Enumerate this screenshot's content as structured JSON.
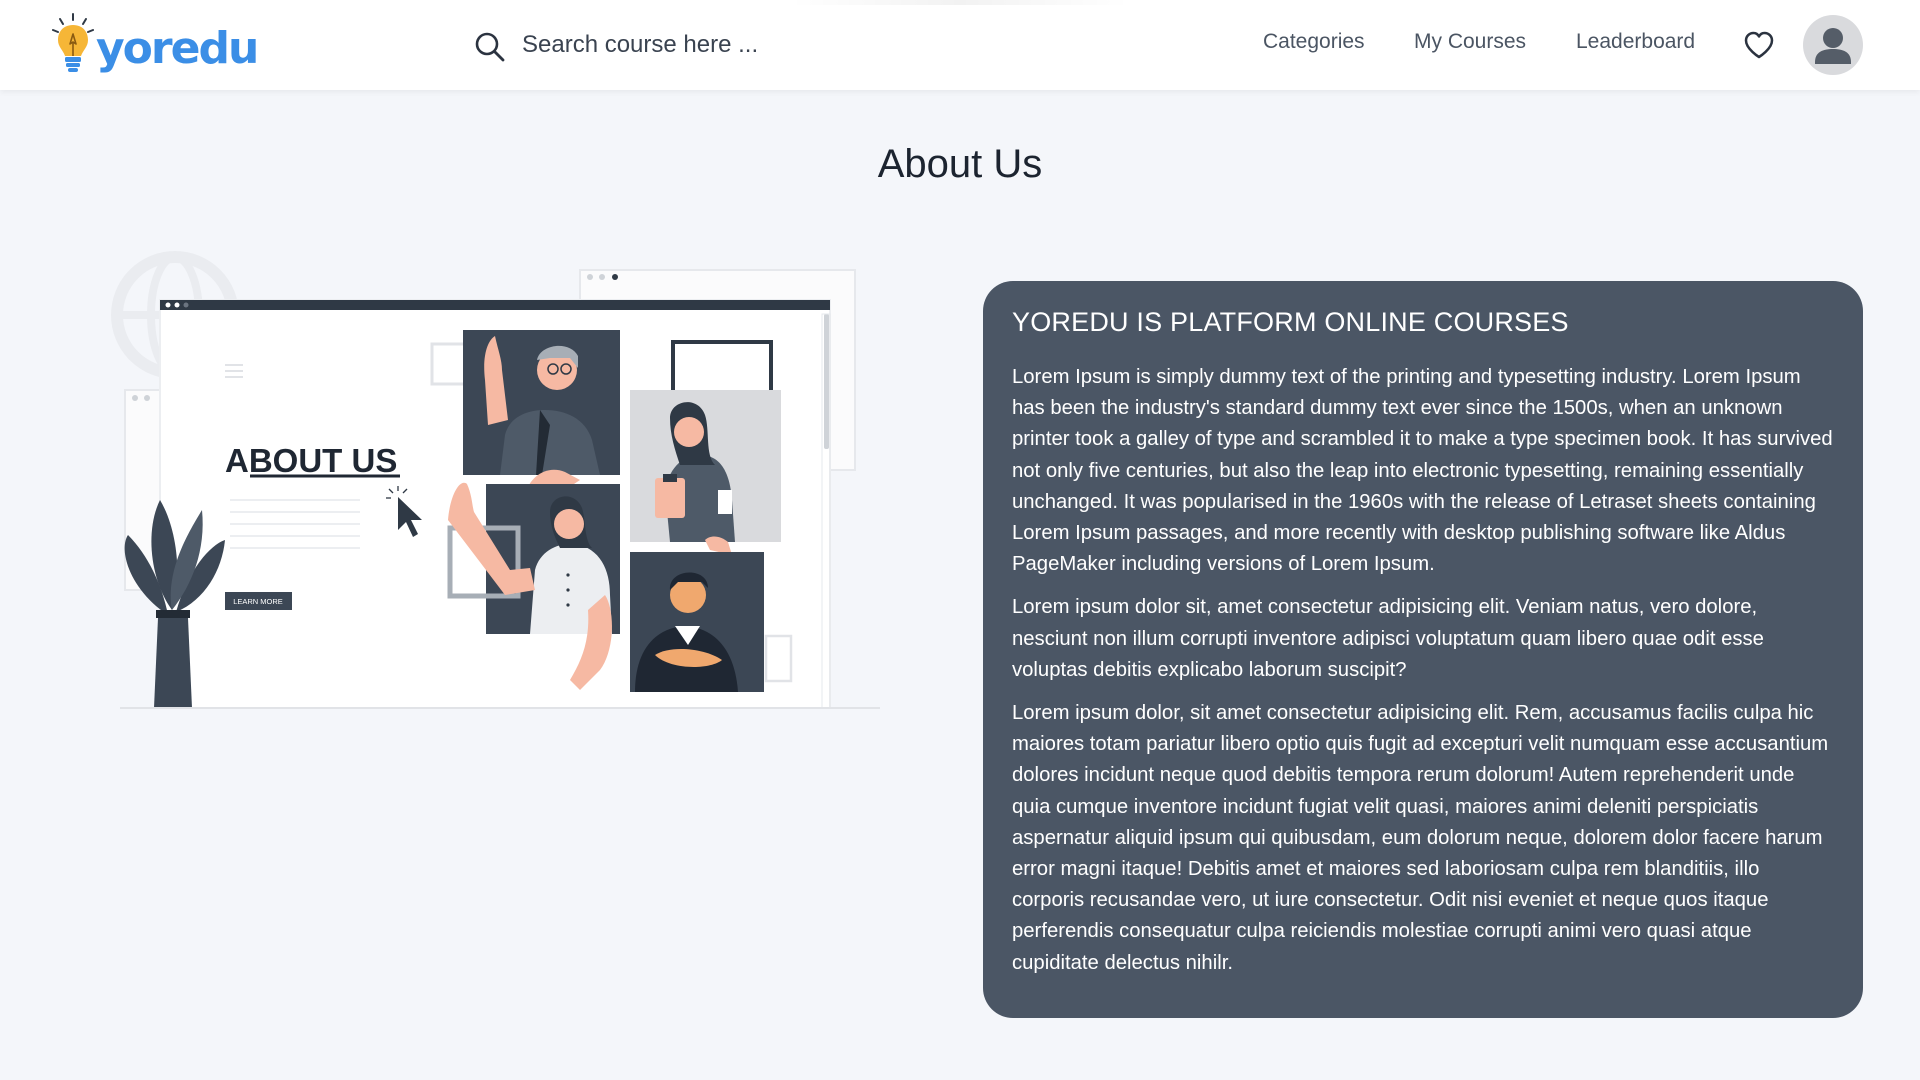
{
  "brand": {
    "name": "yoredu",
    "logo_icon": "lightbulb-icon",
    "color": "#3b8ee6"
  },
  "search": {
    "placeholder": "Search course here ...",
    "icon": "search-icon"
  },
  "nav": {
    "links": [
      {
        "label": "Categories"
      },
      {
        "label": "My Courses"
      },
      {
        "label": "Leaderboard"
      }
    ],
    "wishlist_icon": "heart-icon",
    "avatar_icon": "user-avatar-icon"
  },
  "page": {
    "title": "About Us"
  },
  "illustration": {
    "heading": "ABOUT US",
    "button_label": "LEARN MORE"
  },
  "card": {
    "heading": "YOREDU IS PLATFORM ONLINE COURSES",
    "background": "#4b5665",
    "paragraphs": [
      "Lorem Ipsum is simply dummy text of the printing and typesetting industry. Lorem Ipsum has been the industry's standard dummy text ever since the 1500s, when an unknown printer took a galley of type and scrambled it to make a type specimen book. It has survived not only five centuries, but also the leap into electronic typesetting, remaining essentially unchanged. It was popularised in the 1960s with the release of Letraset sheets containing Lorem Ipsum passages, and more recently with desktop publishing software like Aldus PageMaker including versions of Lorem Ipsum.",
      "Lorem ipsum dolor sit, amet consectetur adipisicing elit. Veniam natus, vero dolore, nesciunt non illum corrupti inventore adipisci voluptatum quam libero quae odit esse voluptas debitis explicabo laborum suscipit?",
      "Lorem ipsum dolor, sit amet consectetur adipisicing elit. Rem, accusamus facilis culpa hic maiores totam pariatur libero optio quis fugit ad excepturi velit numquam esse accusantium dolores incidunt neque quod debitis tempora rerum dolorum! Autem reprehenderit unde quia cumque inventore incidunt fugiat velit quasi, maiores animi deleniti perspiciatis aspernatur aliquid ipsum qui quibusdam, eum dolorum neque, dolorem dolor facere harum error magni itaque! Debitis amet et maiores sed laboriosam culpa rem blanditiis, illo corporis recusandae vero, ut iure consectetur. Odit nisi eveniet et neque quos itaque perferendis consequatur culpa reiciendis molestiae corrupti animi vero quasi atque cupiditate delectus nihilr."
    ]
  }
}
